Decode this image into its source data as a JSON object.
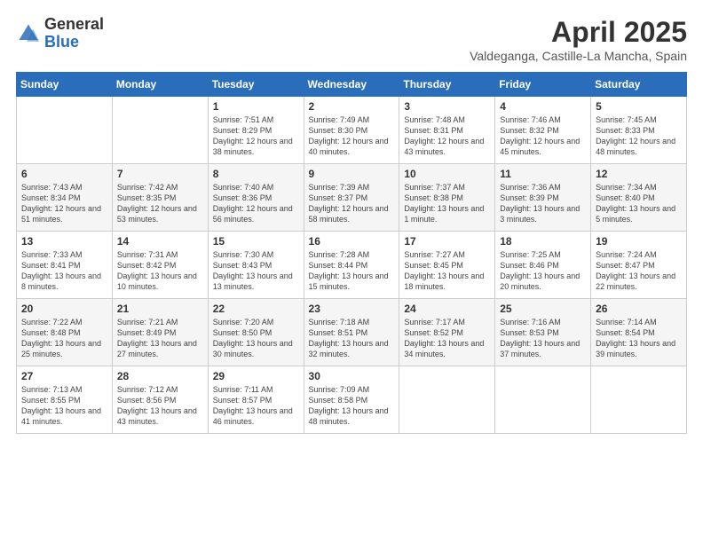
{
  "logo": {
    "general": "General",
    "blue": "Blue"
  },
  "title": "April 2025",
  "subtitle": "Valdeganga, Castille-La Mancha, Spain",
  "weekdays": [
    "Sunday",
    "Monday",
    "Tuesday",
    "Wednesday",
    "Thursday",
    "Friday",
    "Saturday"
  ],
  "weeks": [
    [
      {
        "day": "",
        "info": ""
      },
      {
        "day": "",
        "info": ""
      },
      {
        "day": "1",
        "info": "Sunrise: 7:51 AM\nSunset: 8:29 PM\nDaylight: 12 hours and 38 minutes."
      },
      {
        "day": "2",
        "info": "Sunrise: 7:49 AM\nSunset: 8:30 PM\nDaylight: 12 hours and 40 minutes."
      },
      {
        "day": "3",
        "info": "Sunrise: 7:48 AM\nSunset: 8:31 PM\nDaylight: 12 hours and 43 minutes."
      },
      {
        "day": "4",
        "info": "Sunrise: 7:46 AM\nSunset: 8:32 PM\nDaylight: 12 hours and 45 minutes."
      },
      {
        "day": "5",
        "info": "Sunrise: 7:45 AM\nSunset: 8:33 PM\nDaylight: 12 hours and 48 minutes."
      }
    ],
    [
      {
        "day": "6",
        "info": "Sunrise: 7:43 AM\nSunset: 8:34 PM\nDaylight: 12 hours and 51 minutes."
      },
      {
        "day": "7",
        "info": "Sunrise: 7:42 AM\nSunset: 8:35 PM\nDaylight: 12 hours and 53 minutes."
      },
      {
        "day": "8",
        "info": "Sunrise: 7:40 AM\nSunset: 8:36 PM\nDaylight: 12 hours and 56 minutes."
      },
      {
        "day": "9",
        "info": "Sunrise: 7:39 AM\nSunset: 8:37 PM\nDaylight: 12 hours and 58 minutes."
      },
      {
        "day": "10",
        "info": "Sunrise: 7:37 AM\nSunset: 8:38 PM\nDaylight: 13 hours and 1 minute."
      },
      {
        "day": "11",
        "info": "Sunrise: 7:36 AM\nSunset: 8:39 PM\nDaylight: 13 hours and 3 minutes."
      },
      {
        "day": "12",
        "info": "Sunrise: 7:34 AM\nSunset: 8:40 PM\nDaylight: 13 hours and 5 minutes."
      }
    ],
    [
      {
        "day": "13",
        "info": "Sunrise: 7:33 AM\nSunset: 8:41 PM\nDaylight: 13 hours and 8 minutes."
      },
      {
        "day": "14",
        "info": "Sunrise: 7:31 AM\nSunset: 8:42 PM\nDaylight: 13 hours and 10 minutes."
      },
      {
        "day": "15",
        "info": "Sunrise: 7:30 AM\nSunset: 8:43 PM\nDaylight: 13 hours and 13 minutes."
      },
      {
        "day": "16",
        "info": "Sunrise: 7:28 AM\nSunset: 8:44 PM\nDaylight: 13 hours and 15 minutes."
      },
      {
        "day": "17",
        "info": "Sunrise: 7:27 AM\nSunset: 8:45 PM\nDaylight: 13 hours and 18 minutes."
      },
      {
        "day": "18",
        "info": "Sunrise: 7:25 AM\nSunset: 8:46 PM\nDaylight: 13 hours and 20 minutes."
      },
      {
        "day": "19",
        "info": "Sunrise: 7:24 AM\nSunset: 8:47 PM\nDaylight: 13 hours and 22 minutes."
      }
    ],
    [
      {
        "day": "20",
        "info": "Sunrise: 7:22 AM\nSunset: 8:48 PM\nDaylight: 13 hours and 25 minutes."
      },
      {
        "day": "21",
        "info": "Sunrise: 7:21 AM\nSunset: 8:49 PM\nDaylight: 13 hours and 27 minutes."
      },
      {
        "day": "22",
        "info": "Sunrise: 7:20 AM\nSunset: 8:50 PM\nDaylight: 13 hours and 30 minutes."
      },
      {
        "day": "23",
        "info": "Sunrise: 7:18 AM\nSunset: 8:51 PM\nDaylight: 13 hours and 32 minutes."
      },
      {
        "day": "24",
        "info": "Sunrise: 7:17 AM\nSunset: 8:52 PM\nDaylight: 13 hours and 34 minutes."
      },
      {
        "day": "25",
        "info": "Sunrise: 7:16 AM\nSunset: 8:53 PM\nDaylight: 13 hours and 37 minutes."
      },
      {
        "day": "26",
        "info": "Sunrise: 7:14 AM\nSunset: 8:54 PM\nDaylight: 13 hours and 39 minutes."
      }
    ],
    [
      {
        "day": "27",
        "info": "Sunrise: 7:13 AM\nSunset: 8:55 PM\nDaylight: 13 hours and 41 minutes."
      },
      {
        "day": "28",
        "info": "Sunrise: 7:12 AM\nSunset: 8:56 PM\nDaylight: 13 hours and 43 minutes."
      },
      {
        "day": "29",
        "info": "Sunrise: 7:11 AM\nSunset: 8:57 PM\nDaylight: 13 hours and 46 minutes."
      },
      {
        "day": "30",
        "info": "Sunrise: 7:09 AM\nSunset: 8:58 PM\nDaylight: 13 hours and 48 minutes."
      },
      {
        "day": "",
        "info": ""
      },
      {
        "day": "",
        "info": ""
      },
      {
        "day": "",
        "info": ""
      }
    ]
  ]
}
